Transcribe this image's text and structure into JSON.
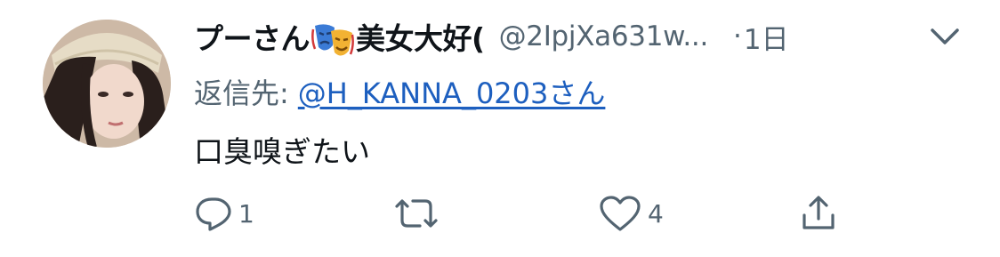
{
  "tweet": {
    "display_name_prefix": "プーさん",
    "display_name_suffix": "美女大好(",
    "handle": "@2IpjXa631w...",
    "dot": "·",
    "time": "1日",
    "reply_prefix": "返信先:",
    "reply_to": "@H_KANNA_0203さん",
    "text": "口臭嗅ぎたい",
    "emoji_icon": "performing-arts-masks",
    "actions": {
      "reply_count": "1",
      "retweet_count": "",
      "like_count": "4"
    }
  },
  "colors": {
    "text": "#0f1419",
    "secondary": "#536471",
    "link": "#1d5fbf"
  }
}
